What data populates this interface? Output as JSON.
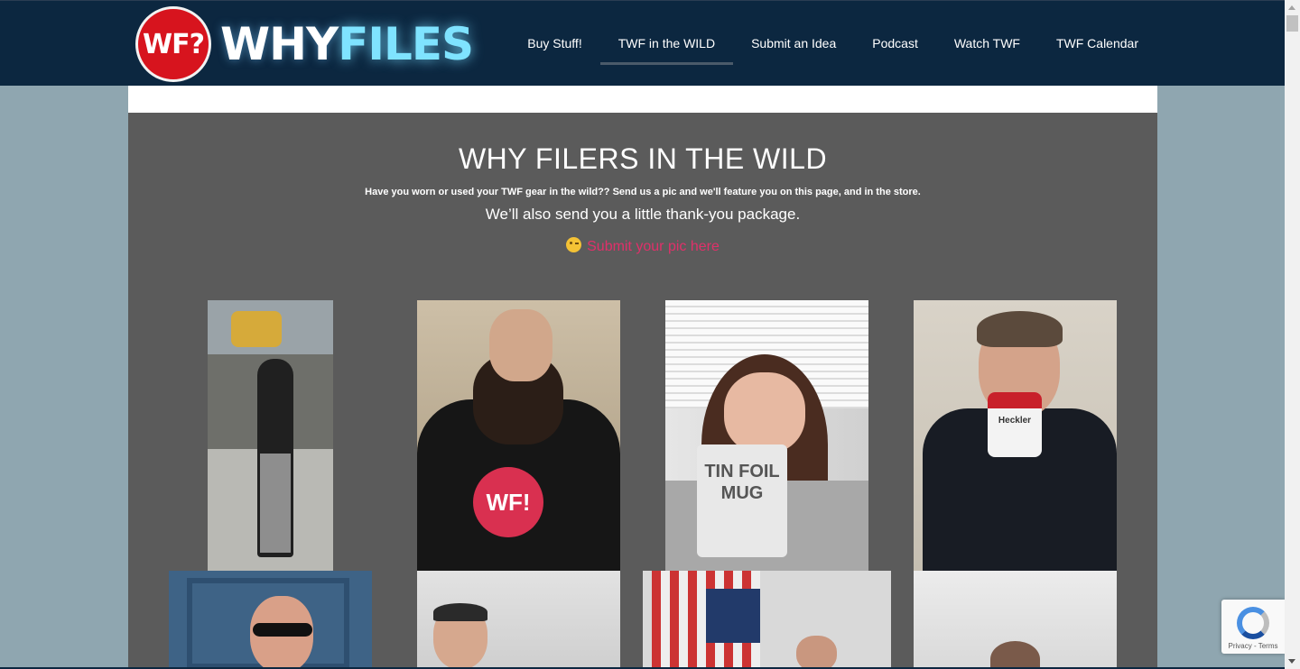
{
  "brand": {
    "badge": "WF?",
    "name_part1": "WHY",
    "name_part2": "FILES"
  },
  "nav": {
    "items": [
      {
        "label": "Buy Stuff!"
      },
      {
        "label": "TWF in the WILD"
      },
      {
        "label": "Submit an Idea"
      },
      {
        "label": "Podcast"
      },
      {
        "label": "Watch TWF"
      },
      {
        "label": "TWF Calendar"
      }
    ],
    "active": "TWF in the WILD"
  },
  "main": {
    "title": "WHY FILERS IN THE WILD",
    "intro": "Have you worn or used your TWF gear in the wild?? Send us a pic and we'll feature you on this page, and in the store.",
    "thanks": "We’ll also send you a little thank-you package.",
    "submit_link": "Submit your pic here"
  },
  "photos": {
    "p2_shirt": "WF!",
    "p3_mug": "TIN FOIL MUG",
    "p4_mug": "Heckler"
  },
  "recaptcha": {
    "privacy": "Privacy",
    "separator": " - ",
    "terms": "Terms"
  },
  "colors": {
    "header_bg": "#0c2740",
    "page_bg": "#8fa6b0",
    "panel_bg": "#5b5b5b",
    "link": "#e0306a",
    "logo_accent": "#7fe3ff",
    "badge_red": "#d7141e"
  }
}
